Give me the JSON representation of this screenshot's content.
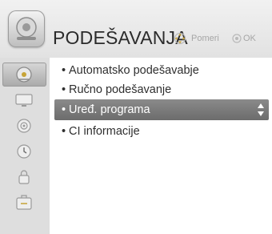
{
  "header": {
    "title": "PODEŠAVANJA",
    "icon": "tv-settings-icon",
    "hints": {
      "move_label": "Pomeri",
      "ok_label": "OK"
    }
  },
  "side_menu": {
    "items": [
      {
        "icon": "satellite-dish-icon",
        "active": true
      },
      {
        "icon": "monitor-icon",
        "active": false
      },
      {
        "icon": "speaker-icon",
        "active": false
      },
      {
        "icon": "clock-icon",
        "active": false
      },
      {
        "icon": "lock-icon",
        "active": false
      },
      {
        "icon": "options-icon",
        "active": false
      }
    ]
  },
  "menu": {
    "bullet": "•",
    "items": [
      {
        "label": "Automatsko podešavabje",
        "selected": false
      },
      {
        "label": "Ručno podešavanje",
        "selected": false
      },
      {
        "label": "Uređ. programa",
        "selected": true
      },
      {
        "label": "CI informacije",
        "selected": false
      }
    ]
  },
  "colors": {
    "selected_row": "#7a7a7a",
    "side_panel": "#dedede",
    "header": "#e8e8e8"
  }
}
